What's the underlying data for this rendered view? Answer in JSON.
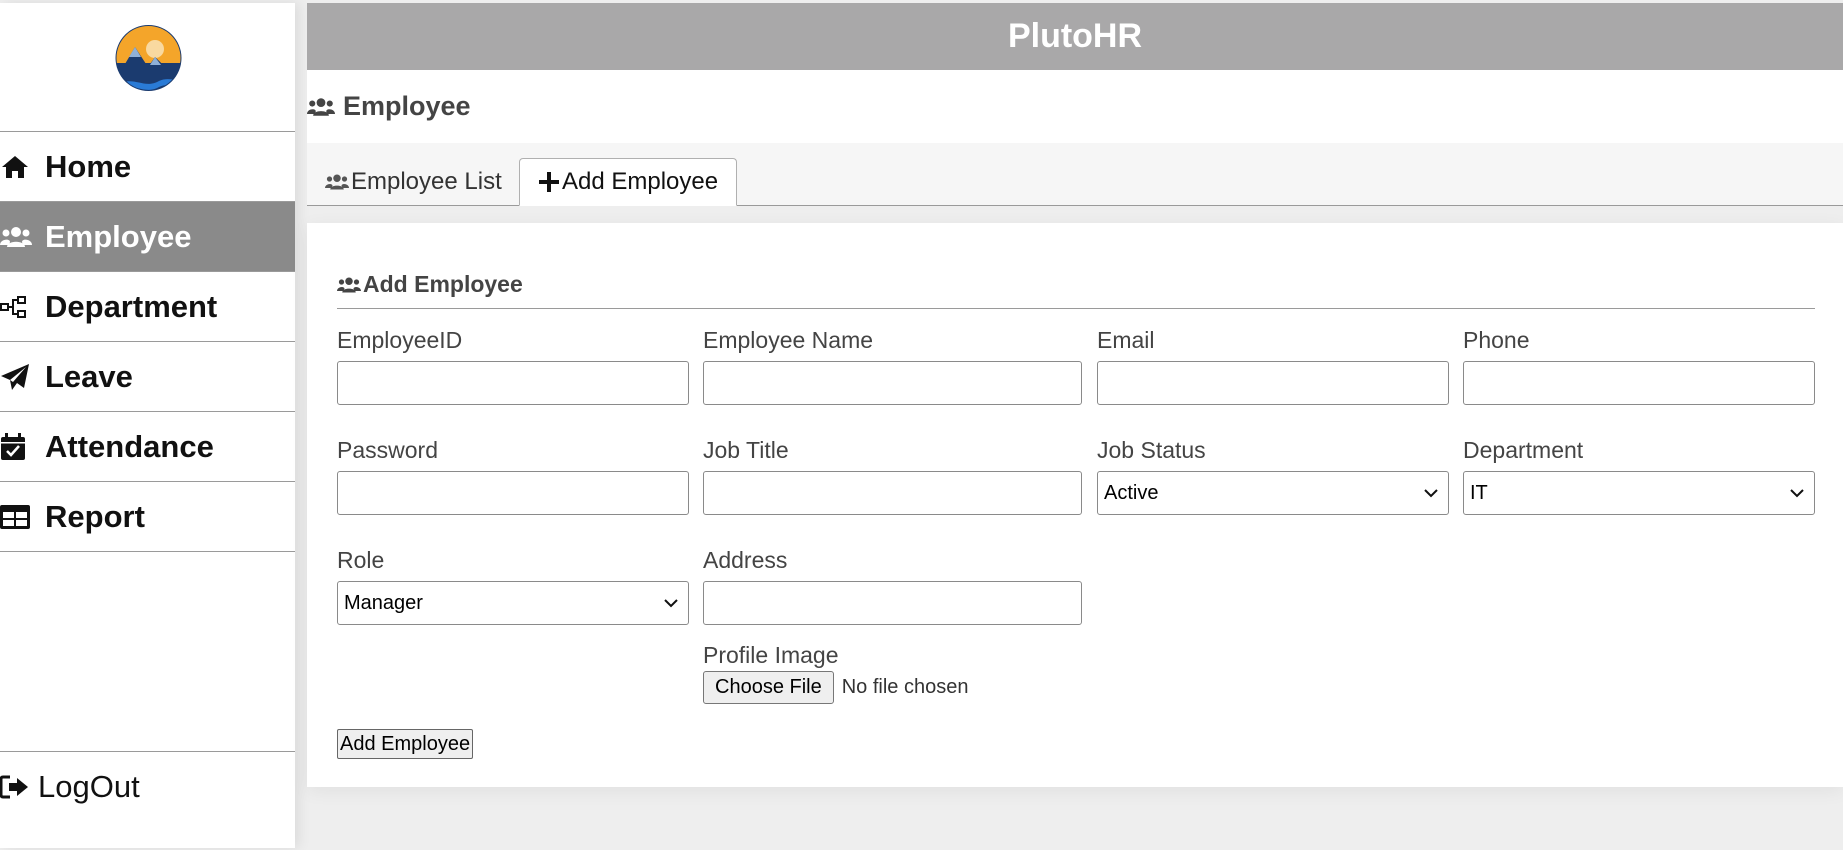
{
  "app": {
    "title": "PlutoHR"
  },
  "sidebar": {
    "items": [
      {
        "label": "Home",
        "icon": "home-icon"
      },
      {
        "label": "Employee",
        "icon": "users-icon",
        "active": true
      },
      {
        "label": "Department",
        "icon": "sitemap-icon"
      },
      {
        "label": "Leave",
        "icon": "paper-plane-icon"
      },
      {
        "label": "Attendance",
        "icon": "calendar-check-icon"
      },
      {
        "label": "Report",
        "icon": "table-icon"
      }
    ],
    "logout_label": "LogOut"
  },
  "page": {
    "title": "Employee"
  },
  "tabs": [
    {
      "label": "Employee List",
      "icon": "users-icon"
    },
    {
      "label": "Add Employee",
      "icon": "plus-icon",
      "active": true
    }
  ],
  "form": {
    "title": "Add Employee",
    "fields": {
      "employee_id": {
        "label": "EmployeeID",
        "value": ""
      },
      "employee_name": {
        "label": "Employee Name",
        "value": ""
      },
      "email": {
        "label": "Email",
        "value": ""
      },
      "phone": {
        "label": "Phone",
        "value": ""
      },
      "password": {
        "label": "Password",
        "value": ""
      },
      "job_title": {
        "label": "Job Title",
        "value": ""
      },
      "job_status": {
        "label": "Job Status",
        "value": "Active"
      },
      "department": {
        "label": "Department",
        "value": "IT"
      },
      "role": {
        "label": "Role",
        "value": "Manager"
      },
      "address": {
        "label": "Address",
        "value": ""
      },
      "profile_image": {
        "label": "Profile Image",
        "button": "Choose File",
        "status": "No file chosen"
      }
    },
    "submit_label": "Add Employee"
  },
  "colors": {
    "header_bg": "#a9a8a9",
    "active_nav_bg": "#8a8a8a",
    "logo_sun": "#f4a52a",
    "logo_navy": "#1b3b6f"
  }
}
